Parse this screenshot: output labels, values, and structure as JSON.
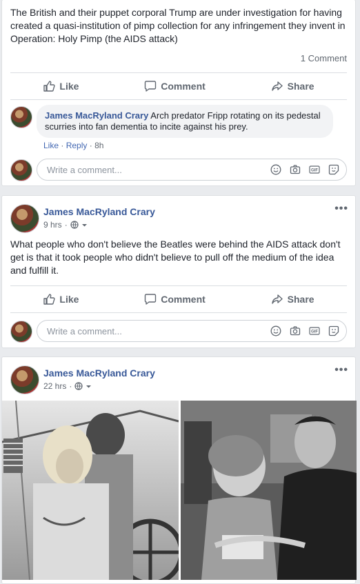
{
  "post1": {
    "text": "The British and their puppet corporal Trump are under investigation for having created a quasi-institution of pimp collection for any infringement they invent in Operation: Holy Pimp (the AIDS attack)",
    "comment_count": "1 Comment",
    "actions": {
      "like": "Like",
      "comment": "Comment",
      "share": "Share"
    },
    "comment": {
      "author": "James MacRyland Crary",
      "text": "Arch predator Fripp rotating on its pedestal scurries into fan dementia to incite against his prey.",
      "like": "Like",
      "separator": "·",
      "reply": "Reply",
      "time": "8h"
    },
    "write_placeholder": "Write a comment..."
  },
  "post2": {
    "author": "James MacRyland Crary",
    "time": "9 hrs",
    "meta_separator": "·",
    "text": "What people who don't believe the Beatles were behind the AIDS attack don't get is that it took people who didn't believe to pull off the medium of the idea and fulfill it.",
    "actions": {
      "like": "Like",
      "comment": "Comment",
      "share": "Share"
    },
    "write_placeholder": "Write a comment..."
  },
  "post3": {
    "author": "James MacRyland Crary",
    "time": "22 hrs",
    "meta_separator": "·"
  },
  "more_glyph": "•••",
  "icons": [
    "thumbs-up-icon",
    "speech-bubble-icon",
    "share-arrow-icon",
    "emoji-icon",
    "camera-icon",
    "gif-icon",
    "sticker-icon",
    "globe-icon",
    "chevron-down-icon"
  ],
  "gif_label": "GIF",
  "colors": {
    "link": "#385898",
    "muted": "#606770",
    "background": "#e9ebee"
  }
}
